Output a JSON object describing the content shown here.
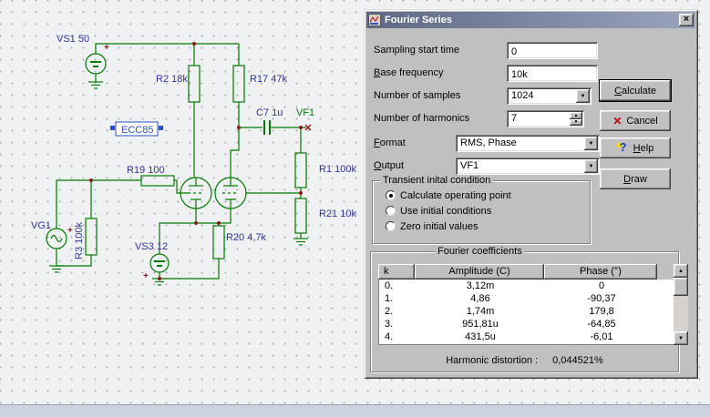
{
  "colors": {
    "wire_green": "#007a00",
    "label_blue": "#333399",
    "output_green": "#007a00",
    "selection_blue": "#2a50c8",
    "junction_red": "#8b1a1a",
    "dialog_bg": "#c0c0c0",
    "titlebar_gradient": [
      "#5f6985",
      "#9aa4bd"
    ]
  },
  "icons": {
    "close": "×",
    "dropdown": "▼",
    "spin_up": "▲",
    "spin_down": "▼",
    "scroll_up": "▲",
    "scroll_down": "▼",
    "cancel_x": "✕",
    "help_q": "?"
  },
  "schematic": {
    "polarity": "+",
    "labels": {
      "vs1": "VS1 50",
      "r2": "R2 18k",
      "r17": "R17 47k",
      "c7": "C7 1u",
      "vf1": "VF1",
      "ecc85": "ECC85",
      "r19": "R19 100",
      "r1": "R1 100k",
      "r21": "R21 10k",
      "vg1": "VG1",
      "r3": "R3 100k",
      "vs3": "VS3 12",
      "r20": "R20 4,7k"
    }
  },
  "dialog": {
    "title": "Fourier Series",
    "fields": {
      "sampling": {
        "label": "Sampling start time",
        "value": "0"
      },
      "base_freq": {
        "label": "Base frequency",
        "value": "10k"
      },
      "samples": {
        "label": "Number of samples",
        "value": "1024"
      },
      "harmonics": {
        "label": "Number of harmonics",
        "value": "7"
      },
      "format": {
        "label": "Format",
        "value": "RMS, Phase"
      },
      "output": {
        "label": "Output",
        "value": "VF1"
      }
    },
    "transient": {
      "title": "Transient inital condition",
      "options": [
        {
          "label": "Calculate operating point",
          "selected": true
        },
        {
          "label": "Use initial conditions",
          "selected": false
        },
        {
          "label": "Zero initial values",
          "selected": false
        }
      ]
    },
    "buttons": {
      "calculate": "Calculate",
      "cancel": "Cancel",
      "help": "Help",
      "draw": "Draw"
    },
    "coefficients": {
      "title": "Fourier coefficients",
      "headers": {
        "k": "k",
        "amplitude": "Amplitude (C)",
        "phase": "Phase (°)"
      },
      "rows": [
        {
          "k": "0.",
          "amp": "3,12m",
          "phase": "0"
        },
        {
          "k": "1.",
          "amp": "4,86",
          "phase": "-90,37"
        },
        {
          "k": "2.",
          "amp": "1,74m",
          "phase": "179,8"
        },
        {
          "k": "3.",
          "amp": "951,81u",
          "phase": "-64,85"
        },
        {
          "k": "4.",
          "amp": "431,5u",
          "phase": "-6,01"
        }
      ],
      "distortion_label": "Harmonic distortion :",
      "distortion_value": "0,044521%"
    }
  }
}
